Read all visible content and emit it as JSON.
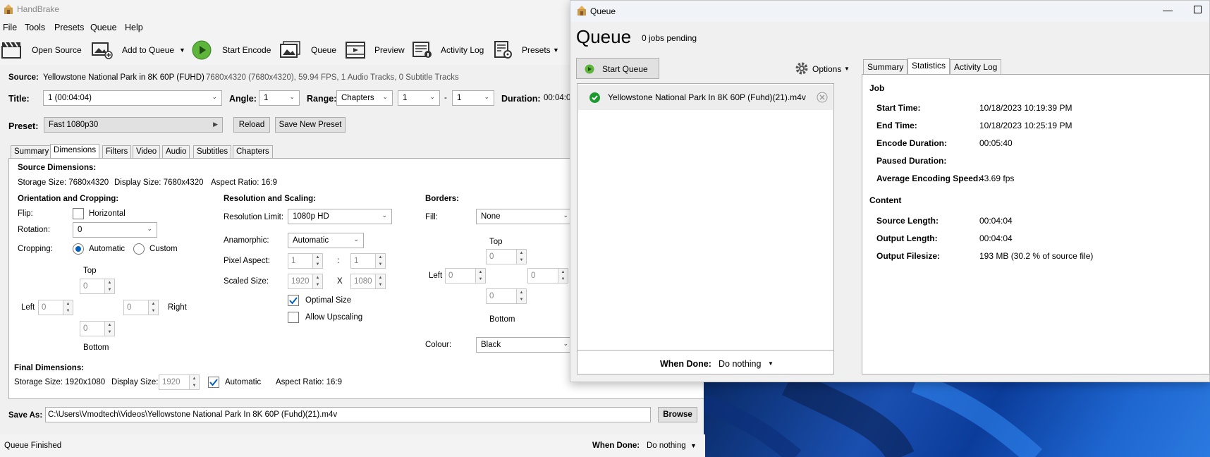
{
  "app": {
    "title": "HandBrake"
  },
  "menu": [
    "File",
    "Tools",
    "Presets",
    "Queue",
    "Help"
  ],
  "toolbar": {
    "open_source": "Open Source",
    "add_to_queue": "Add to Queue",
    "start_encode": "Start Encode",
    "queue": "Queue",
    "preview": "Preview",
    "activity_log": "Activity Log",
    "presets": "Presets"
  },
  "source": {
    "label": "Source:",
    "name": "Yellowstone National Park in 8K 60P (FUHD)",
    "info": "7680x4320 (7680x4320), 59.94 FPS, 1 Audio Tracks, 0 Subtitle Tracks"
  },
  "title_row": {
    "title_label": "Title:",
    "title_value": "1  (00:04:04)",
    "angle_label": "Angle:",
    "angle_value": "1",
    "range_label": "Range:",
    "range_value": "Chapters",
    "range_from": "1",
    "range_sep": "-",
    "range_to": "1",
    "duration_label": "Duration:",
    "duration_value": "00:04:0"
  },
  "preset_row": {
    "label": "Preset:",
    "value": "Fast 1080p30",
    "reload": "Reload",
    "save_new": "Save New Preset"
  },
  "tabs": [
    "Summary",
    "Dimensions",
    "Filters",
    "Video",
    "Audio",
    "Subtitles",
    "Chapters"
  ],
  "dimensions": {
    "source_heading": "Source Dimensions:",
    "storage_size": "Storage Size: 7680x4320",
    "display_size": "Display Size: 7680x4320",
    "aspect_ratio": "Aspect Ratio: 16:9",
    "orientation_heading": "Orientation and Cropping:",
    "flip_label": "Flip:",
    "flip_option": "Horizontal",
    "rotation_label": "Rotation:",
    "rotation_value": "0",
    "cropping_label": "Cropping:",
    "crop_auto": "Automatic",
    "crop_custom": "Custom",
    "top": "Top",
    "bottom": "Bottom",
    "left": "Left",
    "right": "Right",
    "crop_top": "0",
    "crop_bottom": "0",
    "crop_left": "0",
    "crop_right": "0",
    "scaling_heading": "Resolution and Scaling:",
    "res_limit_label": "Resolution Limit:",
    "res_limit_value": "1080p HD",
    "anamorphic_label": "Anamorphic:",
    "anamorphic_value": "Automatic",
    "pixel_aspect_label": "Pixel Aspect:",
    "pixel_aspect_w": "1",
    "pixel_aspect_sep": ":",
    "pixel_aspect_h": "1",
    "scaled_size_label": "Scaled Size:",
    "scaled_w": "1920",
    "scaled_sep": "X",
    "scaled_h": "1080",
    "optimal_size": "Optimal Size",
    "allow_upscaling": "Allow Upscaling",
    "borders_heading": "Borders:",
    "fill_label": "Fill:",
    "fill_value": "None",
    "border_top_label": "Top",
    "border_bottom_label": "Bottom",
    "border_left_label": "Left",
    "border_top": "0",
    "border_bottom": "0",
    "border_left": "0",
    "border_right": "0",
    "colour_label": "Colour:",
    "colour_value": "Black",
    "final_heading": "Final Dimensions:",
    "final_storage": "Storage Size: 1920x1080",
    "final_display_label": "Display Size:",
    "final_display_value": "1920",
    "final_auto": "Automatic",
    "final_aspect": "Aspect Ratio: 16:9"
  },
  "save_as": {
    "label": "Save As:",
    "path": "C:\\Users\\Vmodtech\\Videos\\Yellowstone National Park In 8K 60P (Fuhd)(21).m4v",
    "browse": "Browse"
  },
  "status": {
    "text": "Queue Finished",
    "when_done_label": "When Done:",
    "when_done_value": "Do nothing"
  },
  "queue_window": {
    "title": "Queue",
    "heading": "Queue",
    "pending": "0 jobs pending",
    "start_queue": "Start Queue",
    "options": "Options",
    "job_name": "Yellowstone National Park In 8K 60P (Fuhd)(21).m4v",
    "when_done_label": "When Done:",
    "when_done_value": "Do nothing",
    "tabs": [
      "Summary",
      "Statistics",
      "Activity Log"
    ],
    "stats": {
      "job_heading": "Job",
      "start_time_label": "Start Time:",
      "start_time": "10/18/2023 10:19:39 PM",
      "end_time_label": "End Time:",
      "end_time": "10/18/2023 10:25:19 PM",
      "encode_duration_label": "Encode Duration:",
      "encode_duration": "00:05:40",
      "paused_duration_label": "Paused Duration:",
      "avg_speed_label": "Average Encoding Speed:",
      "avg_speed": "43.69 fps",
      "content_heading": "Content",
      "source_length_label": "Source Length:",
      "source_length": "00:04:04",
      "output_length_label": "Output Length:",
      "output_length": "00:04:04",
      "output_filesize_label": "Output Filesize:",
      "output_filesize": "193 MB (30.2 % of source file)"
    }
  }
}
